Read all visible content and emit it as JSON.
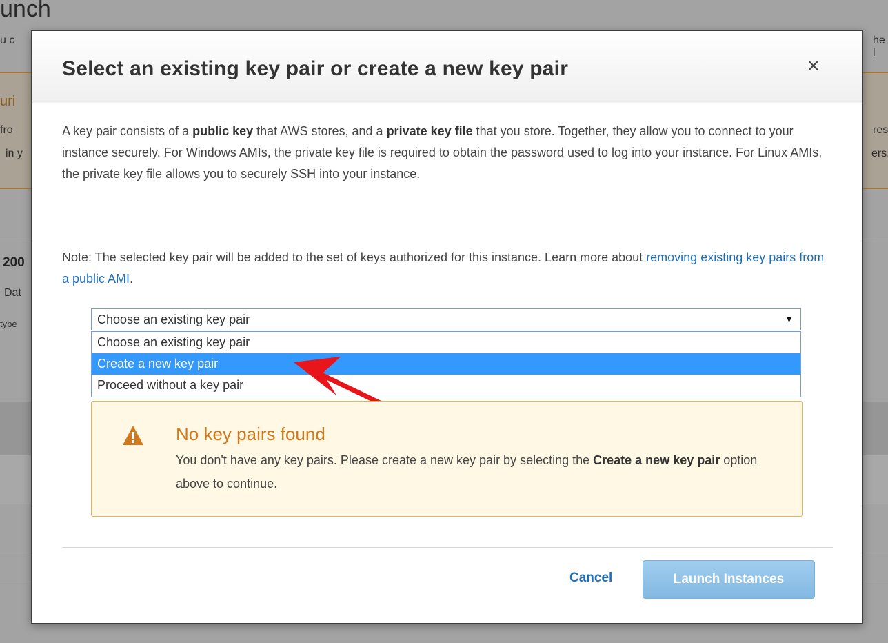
{
  "background": {
    "title": "unch",
    "subtitle_left": "u c",
    "subtitle_right": "he l",
    "warn_left_1": "uri",
    "warn_left_2": "fro",
    "warn_left_3": "in y",
    "warn_right_2": "ress",
    "warn_right_3": "ers.",
    "left_bold": "200",
    "left_line": "Dat",
    "left_small": "type"
  },
  "modal": {
    "title": "Select an existing key pair or create a new key pair",
    "close_glyph": "×",
    "intro": {
      "p1": "A key pair consists of a ",
      "b1": "public key",
      "p2": " that AWS stores, and a ",
      "b2": "private key file",
      "p3": " that you store. Together, they allow you to connect to your instance securely. For Windows AMIs, the private key file is required to obtain the password used to log into your instance. For Linux AMIs, the private key file allows you to securely SSH into your instance."
    },
    "note": {
      "text": "Note: The selected key pair will be added to the set of keys authorized for this instance. Learn more about ",
      "link": "removing existing key pairs from a public AMI",
      "end": "."
    },
    "key_select": {
      "value": "Choose an existing key pair",
      "arrow": "▼",
      "options": [
        "Choose an existing key pair",
        "Create a new key pair",
        "Proceed without a key pair"
      ],
      "highlighted_index": 1
    },
    "warning": {
      "title": "No key pairs found",
      "text1": "You don't have any key pairs. Please create a new key pair by selecting the ",
      "bold": "Create a new key pair",
      "text2": " option above to continue.",
      "color": "#d2791e"
    },
    "buttons": {
      "cancel": "Cancel",
      "launch": "Launch Instances"
    }
  }
}
